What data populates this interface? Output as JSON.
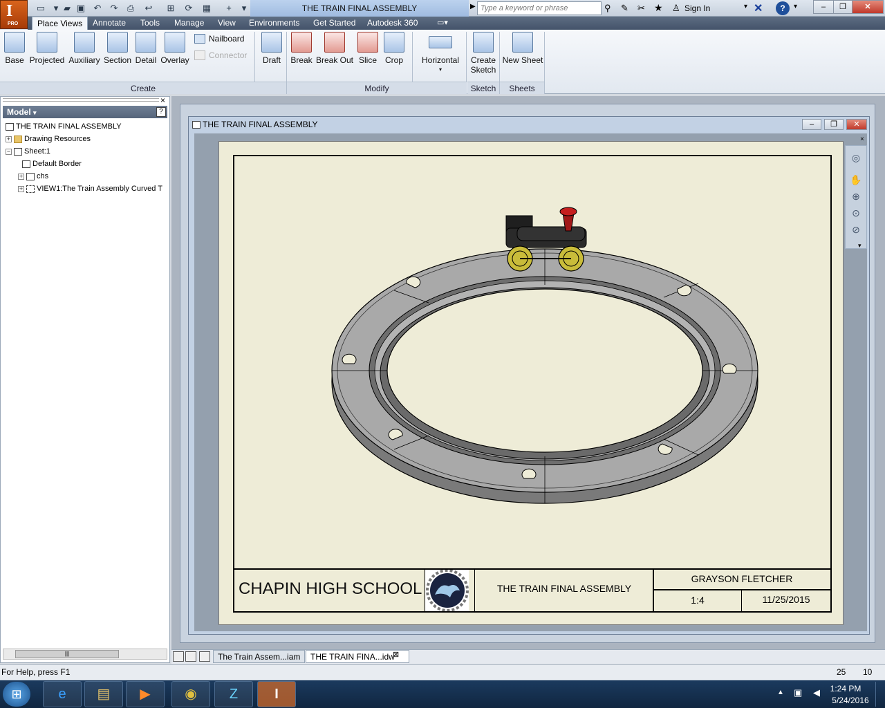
{
  "app": {
    "badge_letter": "I",
    "badge_sub": "PRO"
  },
  "window": {
    "title": "THE TRAIN FINAL ASSEMBLY"
  },
  "search": {
    "placeholder": "Type a keyword or phrase"
  },
  "signin": {
    "label": "Sign In"
  },
  "ribbon_tabs": [
    "Place Views",
    "Annotate",
    "Tools",
    "Manage",
    "View",
    "Environments",
    "Get Started",
    "Autodesk 360"
  ],
  "ribbon": {
    "create_buttons": [
      "Base",
      "Projected",
      "Auxiliary",
      "Section",
      "Detail",
      "Overlay"
    ],
    "nailboard": "Nailboard",
    "connector": "Connector",
    "draft": "Draft",
    "modify_buttons": [
      "Break",
      "Break Out",
      "Slice",
      "Crop"
    ],
    "horizontal": "Horizontal",
    "create_sketch_1": "Create",
    "create_sketch_2": "Sketch",
    "new_sheet": "New Sheet",
    "panels": [
      "Create",
      "Modify",
      "Sketch",
      "Sheets"
    ]
  },
  "browser": {
    "header": "Model",
    "items": [
      "THE TRAIN FINAL ASSEMBLY",
      "Drawing Resources",
      "Sheet:1",
      "Default Border",
      "chs",
      "VIEW1:The Train Assembly Curved T"
    ]
  },
  "drawing": {
    "window_title": "THE TRAIN FINAL ASSEMBLY",
    "school": "CHAPIN HIGH SCHOOL",
    "title": "THE TRAIN FINAL ASSEMBLY",
    "author": "GRAYSON FLETCHER",
    "scale": "1:4",
    "date": "11/25/2015"
  },
  "doc_tabs": [
    "The Train Assem...iam",
    "THE TRAIN FINA...idw"
  ],
  "status": {
    "help": "For Help, press F1",
    "val1": "25",
    "val2": "10"
  },
  "taskbar": {
    "time": "1:24 PM",
    "date": "5/24/2016"
  },
  "colors": {
    "ribbon_tab_bg": "#44536a",
    "app_orange": "#c4511a",
    "sheet_bg": "#eeecd7",
    "track_gray": "#9c9c9c"
  }
}
